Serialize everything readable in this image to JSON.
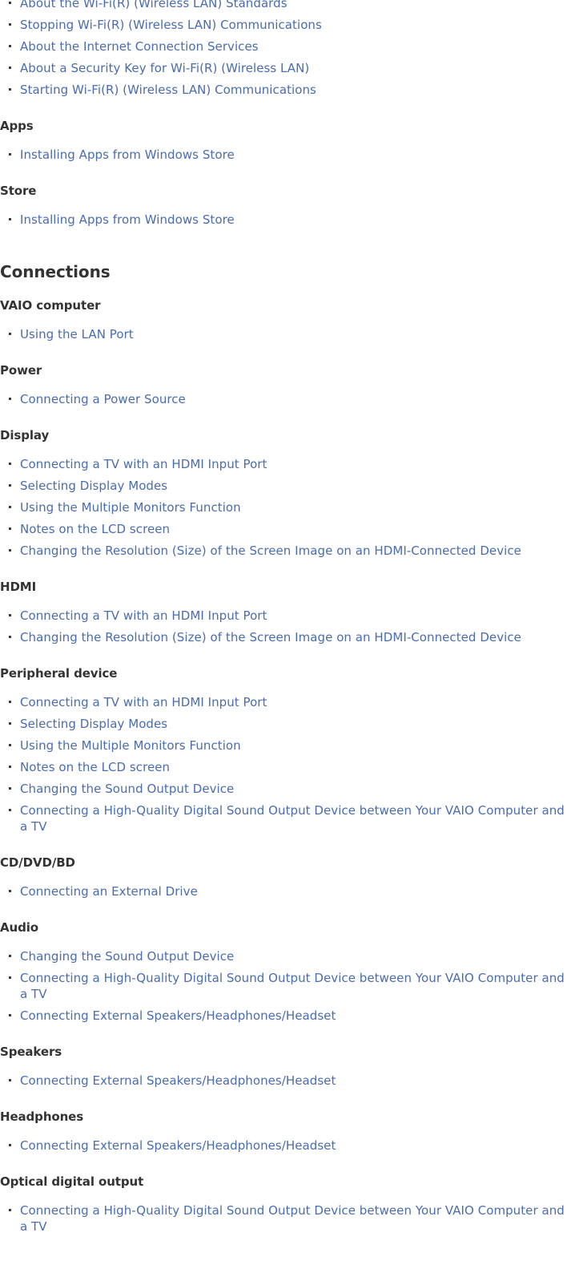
{
  "document": {
    "type": "help-guide-index",
    "link_color": "#4a6cb3",
    "heading_color": "#333333",
    "background_color": "#ffffff",
    "bullet_color": "#3d3d3d"
  },
  "sections": [
    {
      "id": "network-continued",
      "heading": null,
      "heading_level": null,
      "clipped_top": true,
      "groups": [
        {
          "heading": null,
          "links": [
            "About the Wi-Fi(R) (Wireless LAN) Standards",
            "Stopping Wi-Fi(R) (Wireless LAN) Communications",
            "About the Internet Connection Services",
            "About a Security Key for Wi-Fi(R) (Wireless LAN)",
            "Starting Wi-Fi(R) (Wireless LAN) Communications"
          ]
        },
        {
          "heading": "Apps",
          "links": [
            "Installing Apps from Windows Store"
          ]
        },
        {
          "heading": "Store",
          "links": [
            "Installing Apps from Windows Store"
          ]
        }
      ]
    },
    {
      "id": "connections",
      "heading": "Connections",
      "heading_level": "h2",
      "clipped_top": false,
      "groups": [
        {
          "heading": "VAIO computer",
          "links": [
            "Using the LAN Port"
          ]
        },
        {
          "heading": "Power",
          "links": [
            "Connecting a Power Source"
          ]
        },
        {
          "heading": "Display",
          "links": [
            "Connecting a TV with an HDMI Input Port",
            "Selecting Display Modes",
            "Using the Multiple Monitors Function",
            "Notes on the LCD screen",
            "Changing the Resolution (Size) of the Screen Image on an HDMI-Connected Device"
          ]
        },
        {
          "heading": "HDMI",
          "links": [
            "Connecting a TV with an HDMI Input Port",
            "Changing the Resolution (Size) of the Screen Image on an HDMI-Connected Device"
          ]
        },
        {
          "heading": "Peripheral device",
          "links": [
            "Connecting a TV with an HDMI Input Port",
            "Selecting Display Modes",
            "Using the Multiple Monitors Function",
            "Notes on the LCD screen",
            "Changing the Sound Output Device",
            "Connecting a High-Quality Digital Sound Output Device between Your VAIO Computer and a TV"
          ]
        },
        {
          "heading": "CD/DVD/BD",
          "links": [
            "Connecting an External Drive"
          ]
        },
        {
          "heading": "Audio",
          "links": [
            "Changing the Sound Output Device",
            "Connecting a High-Quality Digital Sound Output Device between Your VAIO Computer and a TV",
            "Connecting External Speakers/Headphones/Headset"
          ]
        },
        {
          "heading": "Speakers",
          "links": [
            "Connecting External Speakers/Headphones/Headset"
          ]
        },
        {
          "heading": "Headphones",
          "links": [
            "Connecting External Speakers/Headphones/Headset"
          ]
        },
        {
          "heading": "Optical digital output",
          "links": [
            "Connecting a High-Quality Digital Sound Output Device between Your VAIO Computer and a TV"
          ]
        }
      ]
    }
  ]
}
